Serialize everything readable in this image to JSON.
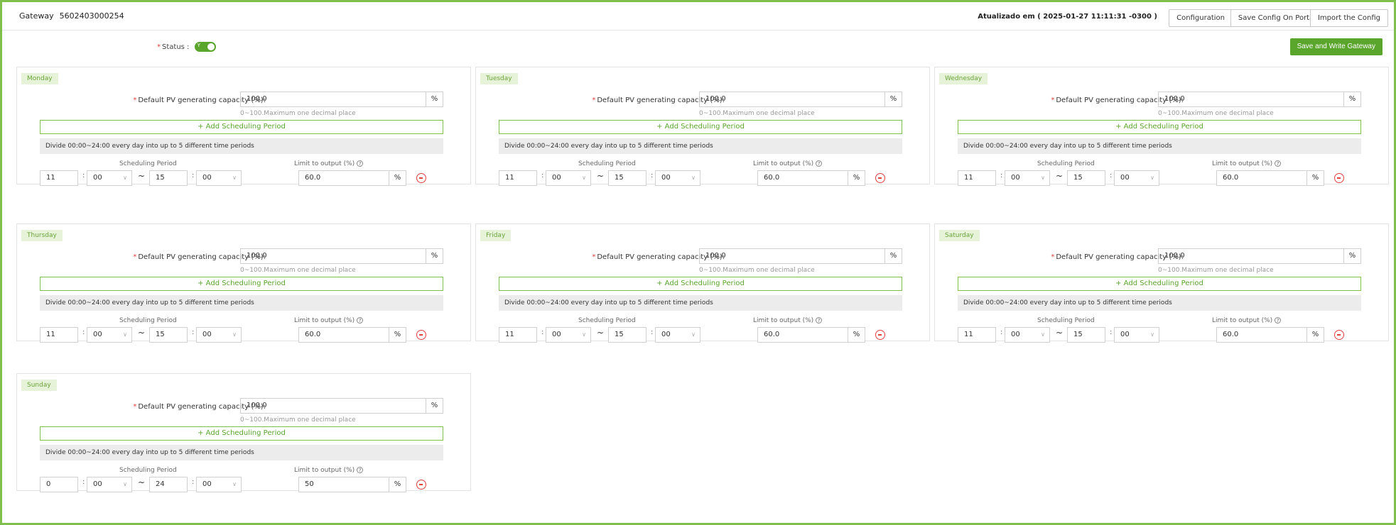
{
  "header": {
    "gateway_label": "Gateway",
    "gateway_id": "5602403000254",
    "updated": "Atualizado em ( 2025-01-27 11:11:31 -0300 )",
    "buttons": [
      "Configuration",
      "Save Config On Portal",
      "Import the Config"
    ]
  },
  "status": {
    "label": "Status :",
    "toggle_text": "Y",
    "enabled": true
  },
  "save_write_label": "Save and Write Gateway",
  "common": {
    "capacity_label": "Default PV generating capacity (%):",
    "capacity_unit": "%",
    "capacity_hint": "0~100.Maximum one decimal place",
    "add_label": "+ Add Scheduling Period",
    "divide_text": "Divide 00:00~24:00 every day into up to 5 different time periods",
    "scheduling_header": "Scheduling Period",
    "limit_header": "Limit to output (%)",
    "colon": ":",
    "tilde": "~",
    "limit_unit": "%"
  },
  "days": [
    {
      "name": "Monday",
      "capacity": "100.0",
      "start_h": "11",
      "start_m": "00",
      "end_h": "15",
      "end_m": "00",
      "limit": "60.0"
    },
    {
      "name": "Tuesday",
      "capacity": "100.0",
      "start_h": "11",
      "start_m": "00",
      "end_h": "15",
      "end_m": "00",
      "limit": "60.0"
    },
    {
      "name": "Wednesday",
      "capacity": "100.0",
      "start_h": "11",
      "start_m": "00",
      "end_h": "15",
      "end_m": "00",
      "limit": "60.0"
    },
    {
      "name": "Thursday",
      "capacity": "100.0",
      "start_h": "11",
      "start_m": "00",
      "end_h": "15",
      "end_m": "00",
      "limit": "60.0"
    },
    {
      "name": "Friday",
      "capacity": "100.0",
      "start_h": "11",
      "start_m": "00",
      "end_h": "15",
      "end_m": "00",
      "limit": "60.0"
    },
    {
      "name": "Saturday",
      "capacity": "100.0",
      "start_h": "11",
      "start_m": "00",
      "end_h": "15",
      "end_m": "00",
      "limit": "60.0"
    },
    {
      "name": "Sunday",
      "capacity": "100.0",
      "start_h": "0",
      "start_m": "00",
      "end_h": "24",
      "end_m": "00",
      "limit": "50"
    }
  ],
  "colors": {
    "accent": "#5aa52c",
    "frame": "#7fbf4d",
    "danger": "#e3403e",
    "tag_bg": "#e7f3d9"
  }
}
